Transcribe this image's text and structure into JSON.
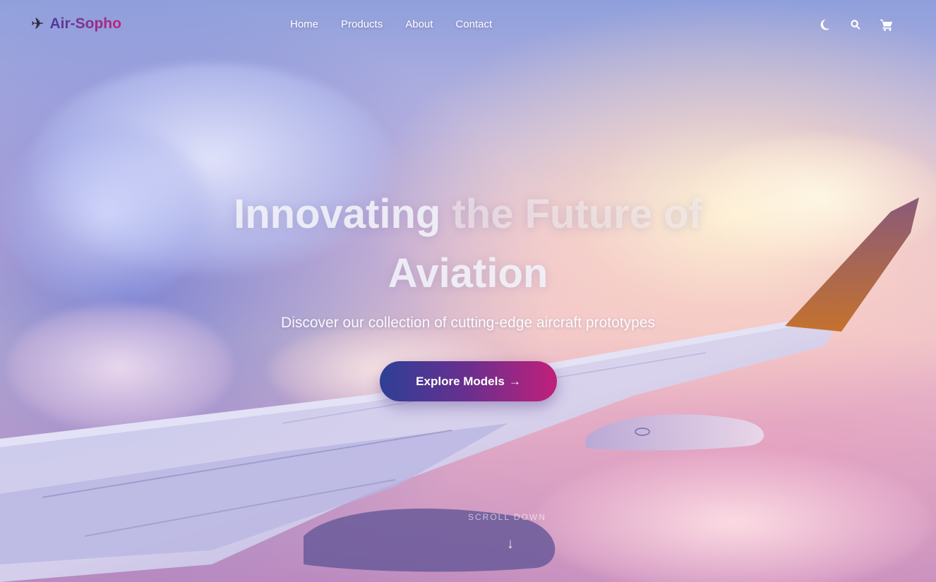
{
  "brand": {
    "name": "Air-Sopho",
    "icon": "plane-icon"
  },
  "nav": {
    "items": [
      {
        "label": "Home"
      },
      {
        "label": "Products"
      },
      {
        "label": "About"
      },
      {
        "label": "Contact"
      }
    ],
    "icons": [
      "moon-icon",
      "search-icon",
      "cart-icon"
    ]
  },
  "hero": {
    "headline_line1_strong": "Innovating",
    "headline_line1_faint": " the Future of",
    "headline_line2": "Aviation",
    "subtitle": "Discover our collection of cutting-edge aircraft prototypes",
    "cta_label": "Explore Models",
    "cta_arrow": "→",
    "scroll_label": "SCROLL DOWN",
    "scroll_arrow": "↓"
  },
  "colors": {
    "gradient_start": "#2e3f96",
    "gradient_end": "#c0207a",
    "text_light": "#ffffff"
  }
}
